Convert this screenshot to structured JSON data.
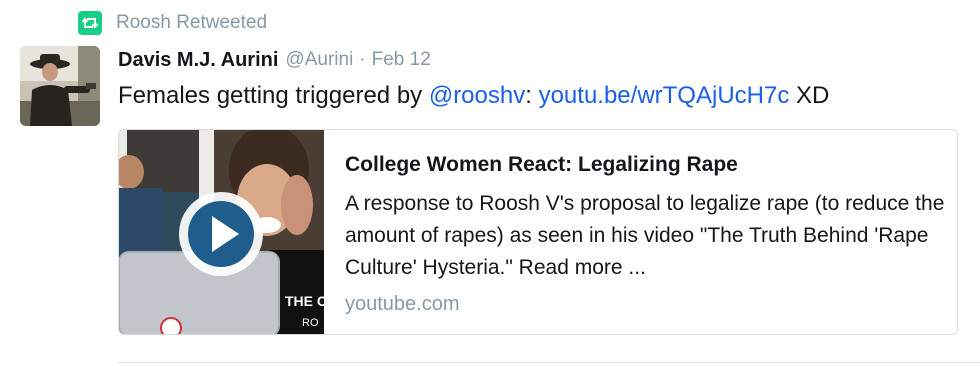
{
  "retweet": {
    "label": "Roosh Retweeted",
    "icon": "retweet-icon",
    "icon_color": "#19cf86"
  },
  "tweet": {
    "display_name": "Davis M.J. Aurini",
    "handle": "@Aurini",
    "separator": "·",
    "timestamp": "Feb 12",
    "text_before": "Females getting triggered by ",
    "mention": "@rooshv",
    "text_colon": ": ",
    "link": "youtu.be/wrTQAjUcH7c",
    "text_after": " XD",
    "link_color": "#1b5fe6"
  },
  "card": {
    "title": "College Women React: Legalizing Rape",
    "description": "A response to Roosh V's proposal to legalize rape (to reduce the amount of rapes) as seen in his video \"The Truth Behind 'Rape Culture' Hysteria.\" Read more ...",
    "domain": "youtube.com",
    "play_icon": "play-icon",
    "thumbnail_overlay_text": "THE C",
    "thumbnail_overlay_text2": "RO"
  }
}
